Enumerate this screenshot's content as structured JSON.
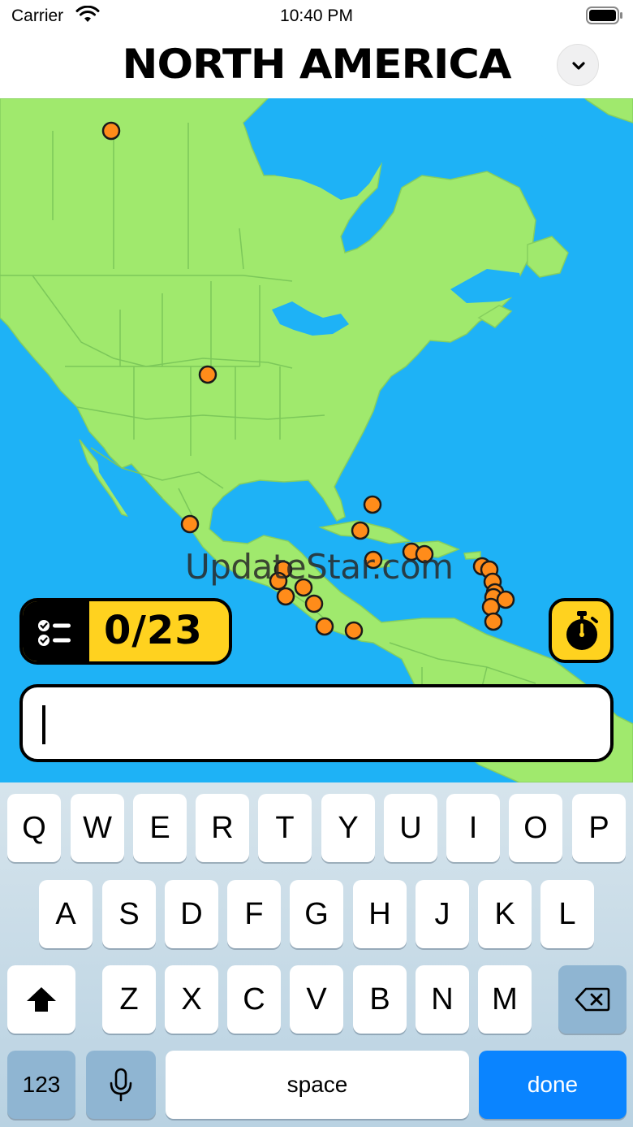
{
  "status_bar": {
    "carrier": "Carrier",
    "time": "10:40 PM"
  },
  "header": {
    "title": "NORTH AMERICA",
    "menu_icon": "chevron-down-icon"
  },
  "map": {
    "region": "North America",
    "colors": {
      "land": "#a0e96d",
      "water": "#1eb2f6",
      "borders": "#7cc85a",
      "marker": "#ff8c1a"
    },
    "watermark": "UpdateStar.com"
  },
  "quiz": {
    "score": "0/23",
    "score_icon": "checklist-icon",
    "timer_icon": "stopwatch-icon",
    "answer_value": ""
  },
  "keyboard": {
    "row1": [
      "Q",
      "W",
      "E",
      "R",
      "T",
      "Y",
      "U",
      "I",
      "O",
      "P"
    ],
    "row2": [
      "A",
      "S",
      "D",
      "F",
      "G",
      "H",
      "J",
      "K",
      "L"
    ],
    "row3": [
      "Z",
      "X",
      "C",
      "V",
      "B",
      "N",
      "M"
    ],
    "shift_icon": "shift-icon",
    "backspace_icon": "backspace-icon",
    "numbers_label": "123",
    "mic_icon": "microphone-icon",
    "space_label": "space",
    "done_label": "done"
  }
}
